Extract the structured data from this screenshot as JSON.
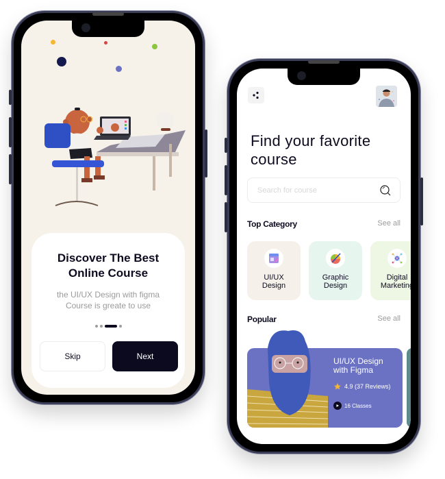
{
  "onboarding": {
    "title": "Discover The Best\nOnline Course",
    "subtitle": "the UI/UX Design with figma\nCourse is greate to use",
    "pager": {
      "total": 4,
      "active_index": 2
    },
    "skip_label": "Skip",
    "next_label": "Next",
    "illustration": "person-at-desk-with-laptop-illustration",
    "confetti_colors": [
      "#f5b731",
      "#d64545",
      "#8cc63f",
      "#141a4e",
      "#6b72c4"
    ]
  },
  "home": {
    "menu_icon": "menu-dots-icon",
    "avatar": "user-avatar-photo",
    "title": "Find your favorite\ncourse",
    "search": {
      "placeholder": "Search for course",
      "value": ""
    },
    "top_category": {
      "label": "Top Category",
      "see_all": "See all",
      "items": [
        {
          "label": "UI/UX\nDesign",
          "icon": "ui-ux-design-icon",
          "bg": "#f5f1ea"
        },
        {
          "label": "Graphic\nDesign",
          "icon": "graphic-design-icon",
          "bg": "#e7f5ef"
        },
        {
          "label": "Digital\nMarketing",
          "icon": "digital-marketing-icon",
          "bg": "#eef6e4"
        }
      ]
    },
    "popular": {
      "label": "Popular",
      "see_all": "See all",
      "courses": [
        {
          "title": "UI/UX Design\nwith Figma",
          "rating": "4.9 (37 Reviews)",
          "classes": "16 Classes",
          "bg": "#6b72c4"
        }
      ]
    }
  }
}
